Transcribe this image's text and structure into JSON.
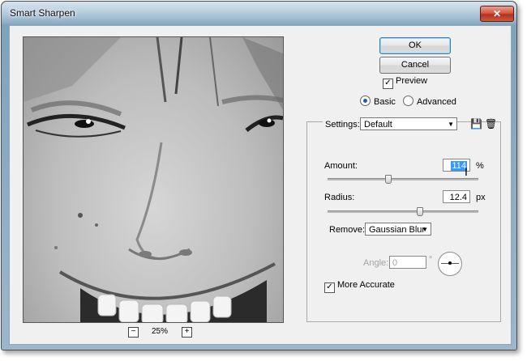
{
  "window": {
    "title": "Smart Sharpen",
    "close_glyph": "✕"
  },
  "preview": {
    "zoom_level": "25%",
    "zoom_out_label": "−",
    "zoom_in_label": "+"
  },
  "buttons": {
    "ok": "OK",
    "cancel": "Cancel"
  },
  "preview_checkbox": {
    "label": "Preview",
    "checked": true
  },
  "mode": {
    "options": [
      "Basic",
      "Advanced"
    ],
    "selected": "Basic"
  },
  "settings": {
    "label": "Settings:",
    "value": "Default"
  },
  "amount": {
    "label": "Amount:",
    "value": "114",
    "unit": "%",
    "slider_fraction": 0.38
  },
  "radius": {
    "label": "Radius:",
    "value": "12.4",
    "unit": "px",
    "slider_fraction": 0.59
  },
  "remove": {
    "label": "Remove:",
    "value": "Gaussian Blur"
  },
  "angle": {
    "label": "Angle:",
    "value": "0",
    "unit": "°"
  },
  "more_accurate": {
    "label": "More Accurate",
    "checked": true
  },
  "icons": {
    "save": "floppy-save-icon",
    "trash": "trash-icon",
    "cursor": "text-cursor-icon"
  }
}
